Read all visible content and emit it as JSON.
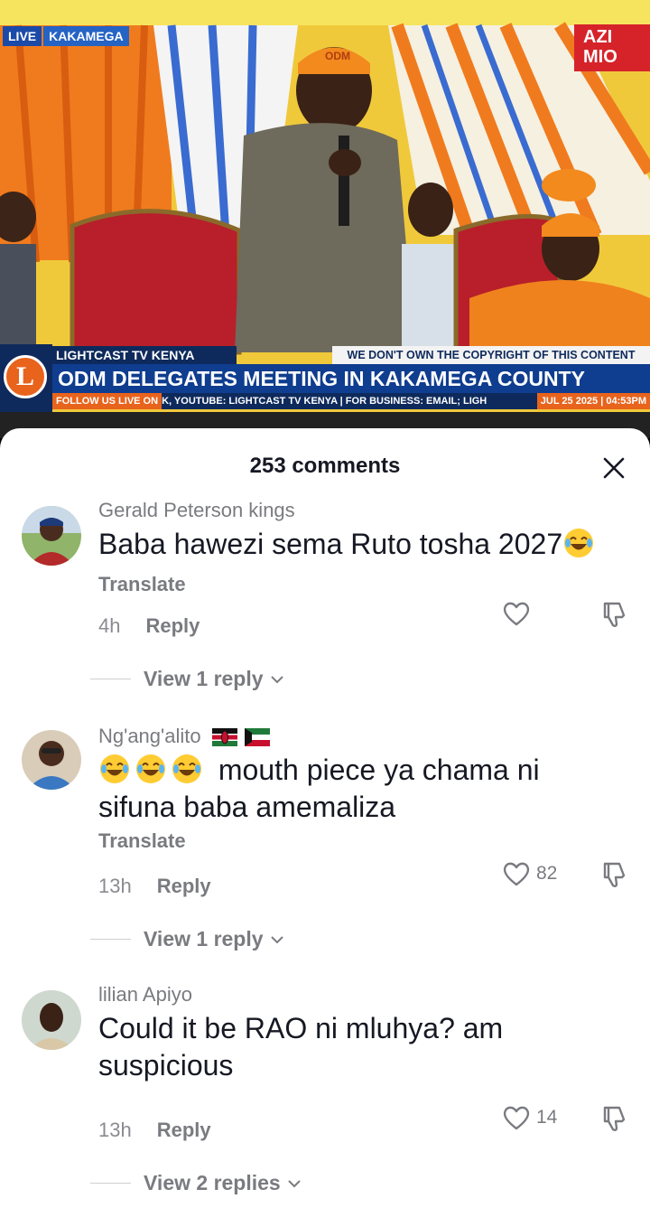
{
  "video": {
    "live_label": "LIVE",
    "location_label": "KAKAMEGA",
    "partner_badge": "AZI MIO",
    "channel_name": "LIGHTCAST TV KENYA",
    "copyright_notice": "WE DON'T OWN THE COPYRIGHT OF THIS CONTENT",
    "headline": "ODM DELEGATES MEETING IN KAKAMEGA COUNTY",
    "ticker_follow": "FOLLOW US LIVE ON",
    "ticker_text": "K, YOUTUBE: LIGHTCAST TV KENYA | FOR BUSINESS: EMAIL; LIGH",
    "ticker_date": "JUL 25 2025 | 04:53PM",
    "logo_letter": "L",
    "cap_text": "ODM"
  },
  "comments_panel": {
    "title": "253 comments",
    "comments": [
      {
        "username": "Gerald Peterson kings",
        "text": "Baba hawezi sema Ruto tosha 2027",
        "translate_label": "Translate",
        "time": "4h",
        "reply_label": "Reply",
        "likes": "",
        "view_replies": "View 1 reply"
      },
      {
        "username": "Ng'ang'alito",
        "text": "mouth piece ya chama ni sifuna baba amemaliza",
        "translate_label": "Translate",
        "time": "13h",
        "reply_label": "Reply",
        "likes": "82",
        "view_replies": "View 1 reply"
      },
      {
        "username": "lilian Apiyo",
        "text": "Could it be RAO ni mluhya? am suspicious",
        "time": "13h",
        "reply_label": "Reply",
        "likes": "14",
        "view_replies": "View 2 replies"
      }
    ]
  },
  "colors": {
    "accent_orange": "#e8631c",
    "text_primary": "#161823",
    "text_secondary": "#7a7b80",
    "broadcast_blue": "#0f3d8f"
  },
  "icons": [
    "close-icon",
    "heart-icon",
    "dislike-icon",
    "chevron-down-icon",
    "laughing-emoji-icon",
    "kenya-flag-icon",
    "kuwait-flag-icon"
  ]
}
